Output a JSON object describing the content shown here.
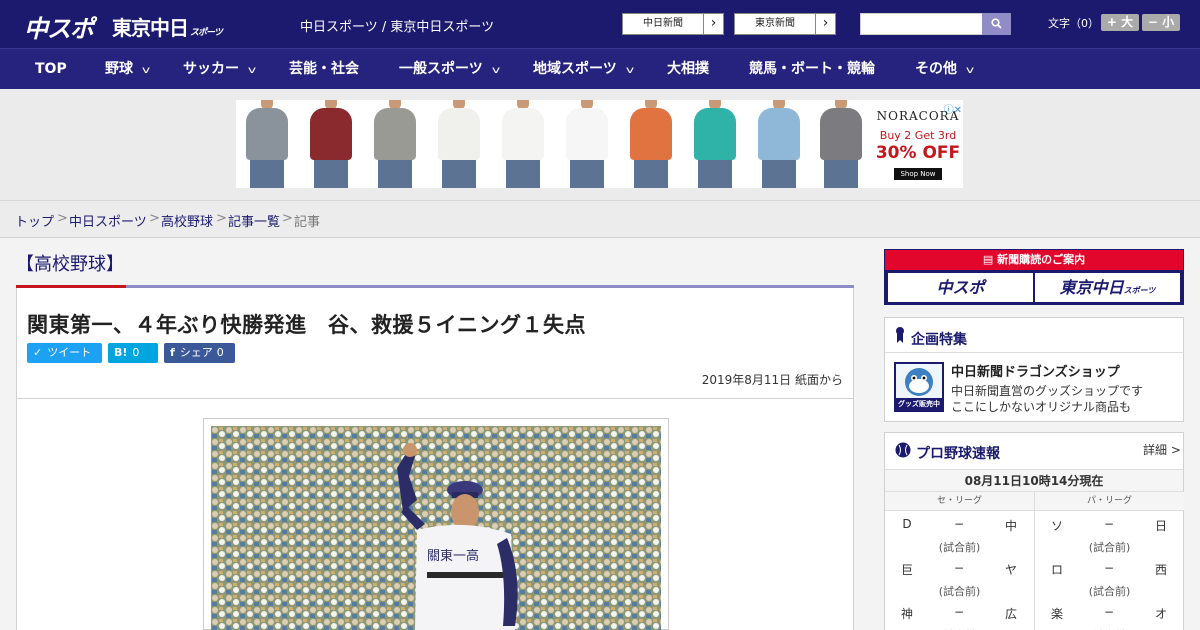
{
  "header": {
    "logo_chuspo": "中スポ",
    "logo_tokyo": "東京中日",
    "logo_tokyo_sub": "スポーツ",
    "site_name": "中日スポーツ / 東京中日スポーツ",
    "paper_links": [
      {
        "label": "中日新聞"
      },
      {
        "label": "東京新聞"
      }
    ],
    "search_placeholder": "",
    "fontsize_label": "文字（0）",
    "fontsize_increase": "+ 大",
    "fontsize_decrease": "− 小"
  },
  "nav": [
    {
      "label": "TOP",
      "has_dropdown": false
    },
    {
      "label": "野球",
      "has_dropdown": true
    },
    {
      "label": "サッカー",
      "has_dropdown": true
    },
    {
      "label": "芸能・社会",
      "has_dropdown": false
    },
    {
      "label": "一般スポーツ",
      "has_dropdown": true
    },
    {
      "label": "地域スポーツ",
      "has_dropdown": true
    },
    {
      "label": "大相撲",
      "has_dropdown": false
    },
    {
      "label": "競馬・ボート・競輪",
      "has_dropdown": false
    },
    {
      "label": "その他",
      "has_dropdown": true
    }
  ],
  "ad": {
    "brand": "NORACORA",
    "offer_line1": "Buy 2 Get 3rd",
    "offer_line2": "30% OFF",
    "cta": "Shop Now",
    "shirt_colors": [
      "#8a929b",
      "#8a2a2e",
      "#9a9a94",
      "#f0f0ec",
      "#f4f4f2",
      "#f6f6f6",
      "#e0733f",
      "#2fb3a8",
      "#8fb8d8",
      "#7c7c80"
    ]
  },
  "breadcrumb": [
    {
      "label": "トップ",
      "link": true
    },
    {
      "label": "中日スポーツ",
      "link": true
    },
    {
      "label": "高校野球",
      "link": true
    },
    {
      "label": "記事一覧",
      "link": true
    },
    {
      "label": "記事",
      "link": false
    }
  ],
  "article": {
    "category": "【高校野球】",
    "headline": "関東第一、４年ぶり快勝発進　谷、救援５イニング１失点",
    "share": {
      "tweet_label": "ツイート",
      "hatena_icon": "B!",
      "hatena_count": "0",
      "facebook_label": "シェア",
      "facebook_count": "0"
    },
    "date": "2019年8月11日 紙面から"
  },
  "sidebar": {
    "promo": {
      "head": "新聞購読のご案内",
      "logo_chuspo": "中スポ",
      "logo_tokyo": "東京中日",
      "logo_tokyo_sub": "スポーツ"
    },
    "feature": {
      "title": "企画特集",
      "thumb_caption": "グッズ販売中",
      "name": "中日新聞ドラゴンズショップ",
      "desc_line1": "中日新聞直営のグッズショップです",
      "desc_line2": "ここにしかないオリジナル商品も"
    },
    "scores": {
      "title": "プロ野球速報",
      "more": "詳細 >",
      "updated": "08月11日10時14分現在",
      "central_label": "セ・リーグ",
      "pacific_label": "パ・リーグ",
      "central": [
        {
          "home": "D",
          "sep": "−",
          "away": "中",
          "status": "(試合前)"
        },
        {
          "home": "巨",
          "sep": "−",
          "away": "ヤ",
          "status": "(試合前)"
        },
        {
          "home": "神",
          "sep": "−",
          "away": "広",
          "status": "(試合前)"
        }
      ],
      "pacific": [
        {
          "home": "ソ",
          "sep": "−",
          "away": "日",
          "status": "(試合前)"
        },
        {
          "home": "ロ",
          "sep": "−",
          "away": "西",
          "status": "(試合前)"
        },
        {
          "home": "楽",
          "sep": "−",
          "away": "オ",
          "status": "(試合前)"
        }
      ]
    }
  },
  "colors": {
    "header_bg": "#1b1a6e",
    "nav_bg": "#26237e",
    "accent_red": "#c4161c",
    "accent_purple": "#8f8cc8",
    "twitter": "#1da1f2",
    "hatena": "#00a4de",
    "facebook": "#3b5998"
  }
}
